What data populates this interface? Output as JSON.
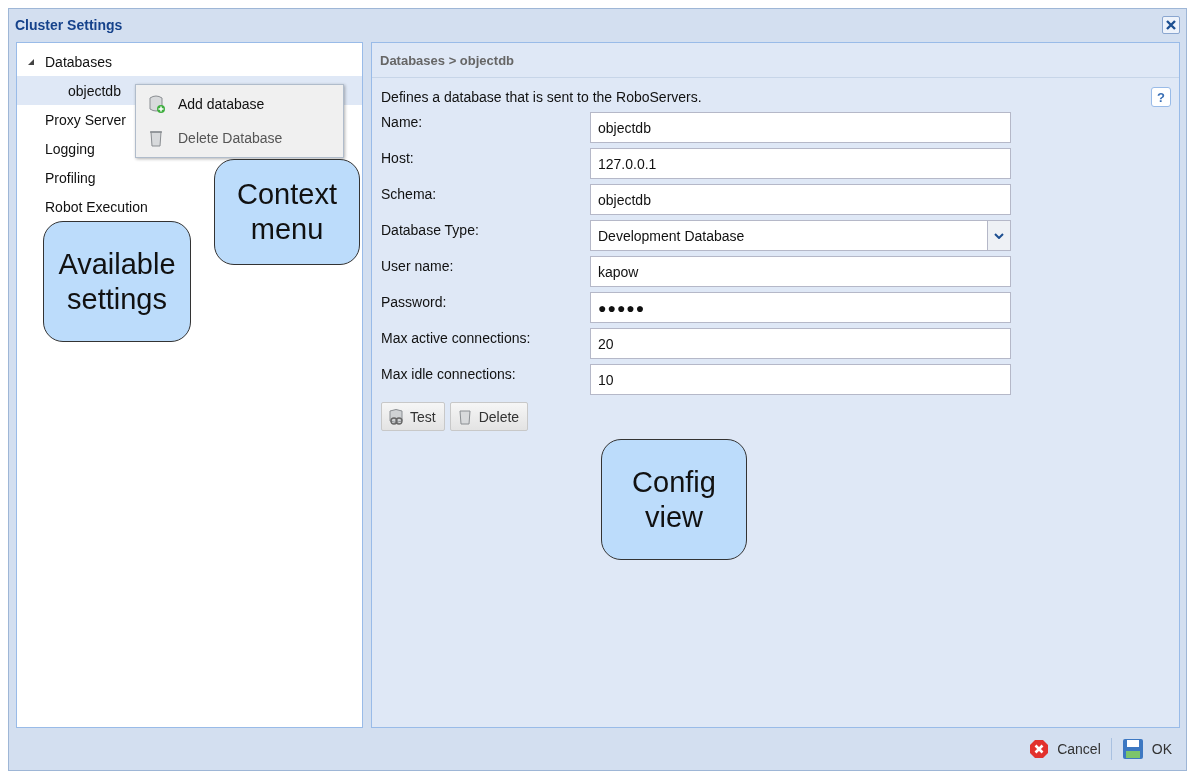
{
  "window": {
    "title": "Cluster Settings"
  },
  "tree": [
    {
      "label": "Databases",
      "expanded": true,
      "selected": false,
      "children": [
        {
          "label": "objectdb",
          "selected": true
        }
      ]
    },
    {
      "label": "Proxy Server",
      "selected": false
    },
    {
      "label": "Logging",
      "selected": false
    },
    {
      "label": "Profiling",
      "selected": false
    },
    {
      "label": "Robot Execution",
      "selected": false
    }
  ],
  "context_menu": {
    "items": [
      {
        "label": "Add database",
        "kind": "add"
      },
      {
        "label": "Delete Database",
        "kind": "delete"
      }
    ]
  },
  "config": {
    "breadcrumb": "Databases > objectdb",
    "description": "Defines a database that is sent to the RoboServers.",
    "help": "?",
    "fields": [
      {
        "label": "Name:",
        "value": "objectdb",
        "kind": "text"
      },
      {
        "label": "Host:",
        "value": "127.0.0.1",
        "kind": "text"
      },
      {
        "label": "Schema:",
        "value": "objectdb",
        "kind": "text"
      },
      {
        "label": "Database Type:",
        "value": "Development Database",
        "kind": "select"
      },
      {
        "label": "User name:",
        "value": "kapow",
        "kind": "text"
      },
      {
        "label": "Password:",
        "value": "●●●●●",
        "kind": "password"
      },
      {
        "label": "Max active connections:",
        "value": "20",
        "kind": "text"
      },
      {
        "label": "Max idle connections:",
        "value": "10",
        "kind": "text"
      }
    ],
    "buttons": [
      {
        "label": "Test",
        "kind": "test"
      },
      {
        "label": "Delete",
        "kind": "delete"
      }
    ]
  },
  "callouts": [
    {
      "text": "Context menu",
      "kind": "menu"
    },
    {
      "text": "Available settings",
      "kind": "settings"
    },
    {
      "text": "Config view",
      "kind": "config"
    }
  ],
  "footer": {
    "buttons": [
      {
        "label": "Cancel",
        "kind": "cancel"
      },
      {
        "label": "OK",
        "kind": "ok"
      }
    ]
  }
}
